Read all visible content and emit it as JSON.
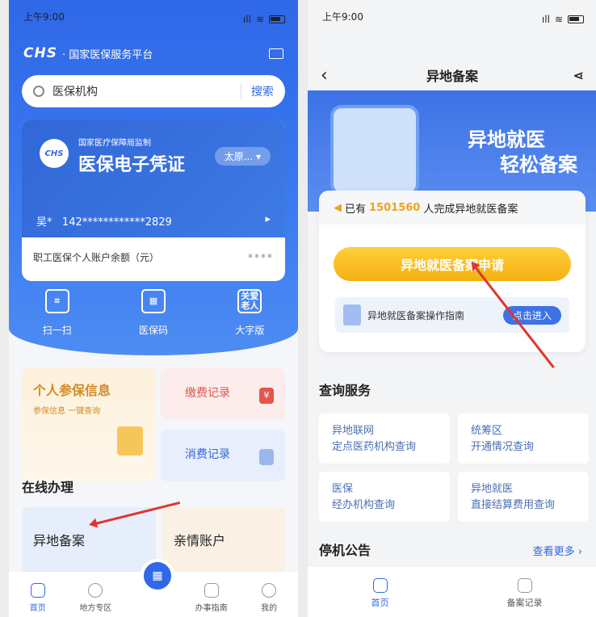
{
  "left": {
    "status": {
      "time": "上午9:00"
    },
    "brand": {
      "logo": "CHS",
      "name": "· 国家医保服务平台"
    },
    "search": {
      "placeholder": "医保机构",
      "button": "搜索"
    },
    "card": {
      "supervisor": "国家医疗保障局监制",
      "logo_text": "CHS",
      "title": "医保电子凭证",
      "city": "太原... ▾",
      "name": "吴*",
      "id": "142************2829",
      "arrow": "▸",
      "balance_label": "职工医保个人账户余额（元）",
      "balance_mask": "****"
    },
    "quick": [
      {
        "label": "扫一扫",
        "icon": "⌗"
      },
      {
        "label": "医保码",
        "icon": "▦"
      },
      {
        "label": "大字版",
        "icon": "关爱老人"
      }
    ],
    "tiles": {
      "personal_title": "个人参保信息",
      "personal_sub": "参保信息 一键查询",
      "payment": "缴费记录",
      "payment_icon": "¥",
      "consume": "消费记录"
    },
    "online": {
      "title": "在线办理",
      "remote": "异地备案",
      "family": "亲情账户"
    },
    "tabs": [
      "首页",
      "地方专区",
      "",
      "办事指南",
      "我的"
    ],
    "fab": "▦"
  },
  "right": {
    "status": {
      "time": "上午9:00"
    },
    "nav": {
      "title": "异地备案",
      "back": "‹",
      "share": "⋖"
    },
    "hero": {
      "line1": "异地就医",
      "line2": "轻松备案"
    },
    "notice": {
      "prefix": "已有",
      "count": "1501560",
      "suffix": "人完成异地就医备案"
    },
    "apply": "异地就医备案申请",
    "guide": {
      "text": "异地就医备案操作指南",
      "enter": "点击进入"
    },
    "query_title": "查询服务",
    "cells": [
      {
        "l1": "异地联网",
        "l2": "定点医药机构查询"
      },
      {
        "l1": "统筹区",
        "l2": "开通情况查询"
      },
      {
        "l1": "医保",
        "l2": "经办机构查询"
      },
      {
        "l1": "异地就医",
        "l2": "直接结算费用查询"
      }
    ],
    "notice_title": "停机公告",
    "more": "查看更多 ›",
    "tabs": [
      "首页",
      "备案记录"
    ]
  },
  "colors": {
    "primary": "#2f68e8",
    "accent": "#f3b012",
    "arrow": "#e1342e"
  }
}
